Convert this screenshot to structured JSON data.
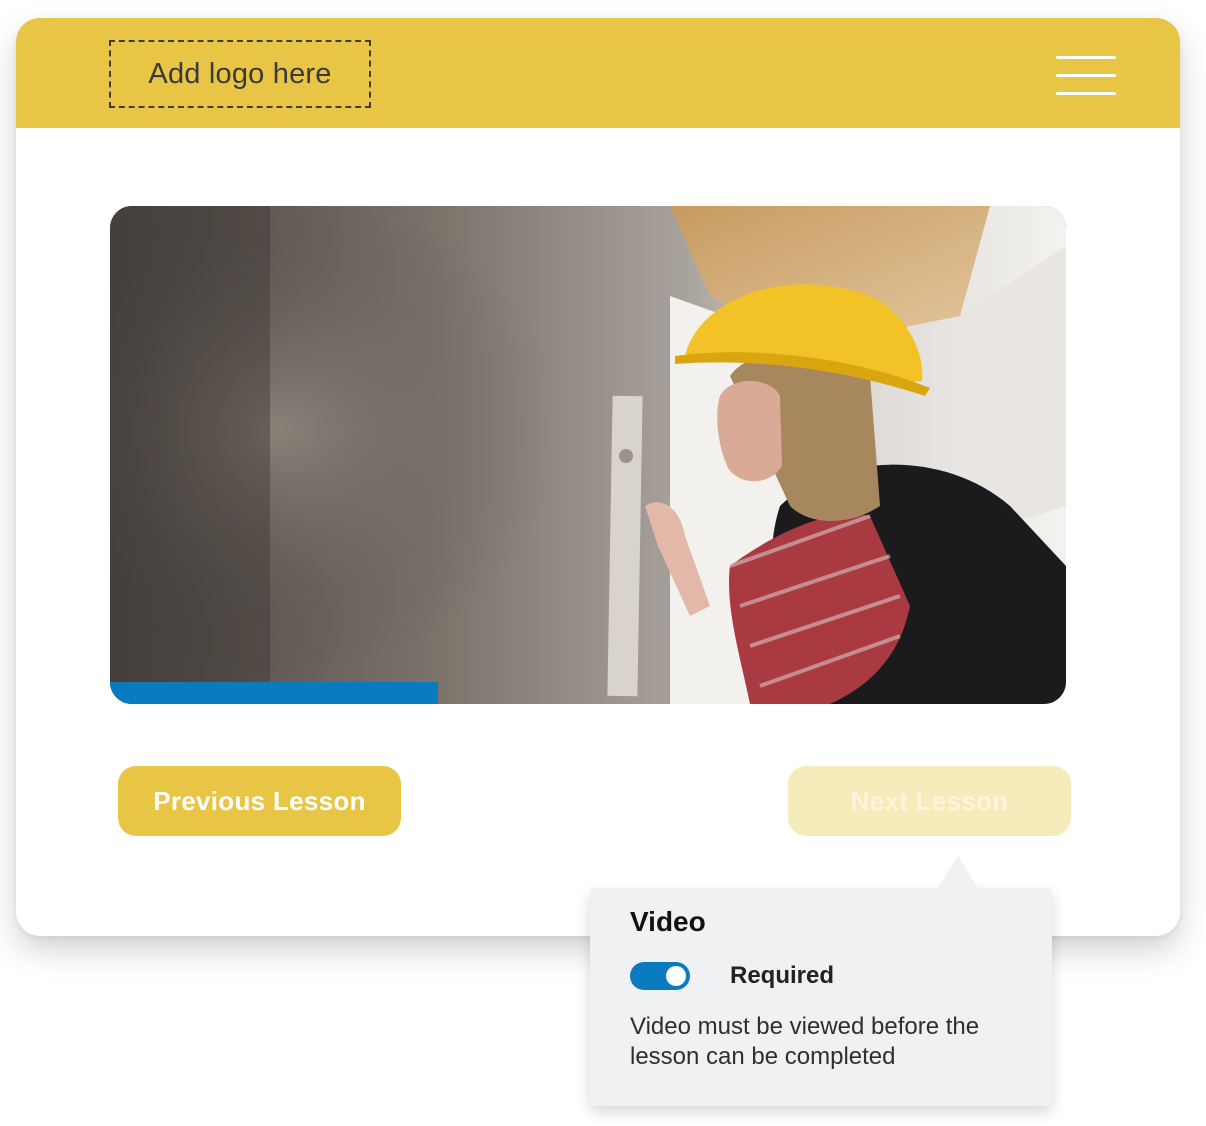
{
  "header": {
    "logo_placeholder": "Add logo here",
    "menu_icon": "hamburger-menu-icon",
    "background_color": "#e8c545"
  },
  "video": {
    "description_icon": "video-thumbnail",
    "progress_fraction": 0.343,
    "progress_color": "#0a7bc0"
  },
  "navigation": {
    "previous_label": "Previous Lesson",
    "next_label": "Next Lesson",
    "next_enabled": false
  },
  "popover": {
    "title": "Video",
    "toggle_on": true,
    "toggle_color": "#0a7bc0",
    "required_label": "Required",
    "description": "Video must be viewed before the lesson can be completed"
  }
}
